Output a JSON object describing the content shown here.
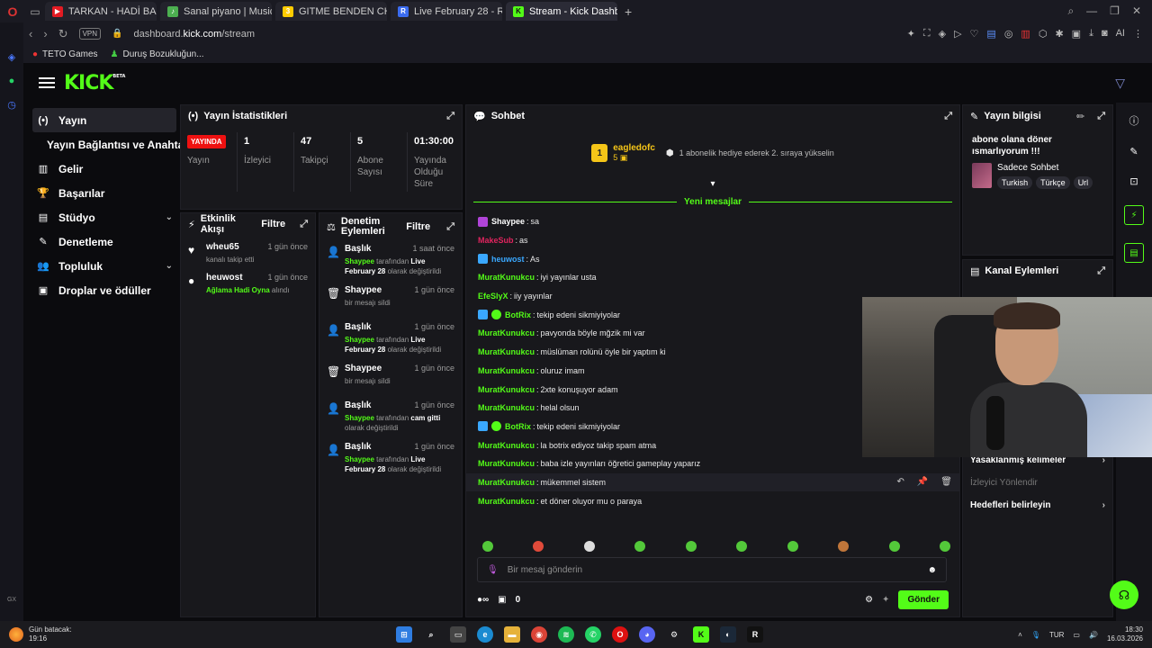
{
  "browser": {
    "tabs": [
      {
        "label": "TARKAN - HADİ BAKALIM",
        "color": "#e31b23",
        "glyph": "▶"
      },
      {
        "label": "Sanal piyano | Musicca",
        "color": "#4caf50",
        "glyph": "♪"
      },
      {
        "label": "GITME BENDEN CHORDS",
        "color": "#ffcc00",
        "glyph": "3"
      },
      {
        "label": "Live February 28 - Restream",
        "color": "#3b6cf0",
        "glyph": "R"
      },
      {
        "label": "Stream - Kick Dashboard",
        "color": "#53fc18",
        "glyph": "K"
      }
    ],
    "url_prefix": "dashboard.",
    "url_domain": "kick.com",
    "url_path": "/stream",
    "vpn_label": "VPN",
    "ai_label": "AI",
    "bookmarks": [
      "TETO Games",
      "Duruş Bozukluğun..."
    ]
  },
  "app": {
    "logo": "KICK",
    "logo_badge": "BETA",
    "sidebar": [
      {
        "label": "Yayın",
        "icon": "broadcast-icon",
        "glyph": "(•)",
        "active": true
      },
      {
        "label": "Yayın Bağlantısı ve Anahtarı",
        "sub": true
      },
      {
        "label": "Gelir",
        "icon": "chart-icon",
        "glyph": "▥"
      },
      {
        "label": "Başarılar",
        "icon": "trophy-icon",
        "glyph": "🏆"
      },
      {
        "label": "Stüdyo",
        "icon": "studio-icon",
        "glyph": "▤",
        "chevron": true
      },
      {
        "label": "Denetleme",
        "icon": "wrench-icon",
        "glyph": "✎"
      },
      {
        "label": "Topluluk",
        "icon": "community-icon",
        "glyph": "👥",
        "chevron": true
      },
      {
        "label": "Droplar ve ödüller",
        "icon": "gift-icon",
        "glyph": "▣"
      }
    ]
  },
  "stats": {
    "title": "Yayın İstatistikleri",
    "live_badge": "YAYINDA",
    "items": [
      {
        "value": "",
        "label": "Yayın"
      },
      {
        "value": "1",
        "label": "İzleyici"
      },
      {
        "value": "47",
        "label": "Takipçi"
      },
      {
        "value": "5",
        "label": "Abone Sayısı"
      },
      {
        "value": "01:30:00",
        "label": "Yayında Olduğu Süre"
      }
    ]
  },
  "activity": {
    "title": "Etkinlik Akışı",
    "filter": "Filtre",
    "items": [
      {
        "icon": "heart-icon",
        "glyph": "♥",
        "user": "wheu65",
        "time": "1 gün önce",
        "text": "kanalı takip etti"
      },
      {
        "icon": "redeem-icon",
        "glyph": "●",
        "user": "heuwost",
        "time": "1 gün önce",
        "highlight": "Ağlama Hadi Oyna",
        "text": " alındı"
      }
    ]
  },
  "moderation": {
    "title": "Denetim Eylemleri",
    "filter": "Filtre",
    "items": [
      {
        "icon": "user-edit-icon",
        "glyph": "👤",
        "title": "Başlık",
        "time": "1 saat önce",
        "actor": "Shaypee",
        "mid": " tarafından ",
        "value": "Live February 28",
        "end": " olarak değiştirildi"
      },
      {
        "icon": "trash-icon",
        "glyph": "🗑",
        "title": "Shaypee",
        "time": "1 gün önce",
        "plain": "bir mesajı sildi"
      },
      {
        "icon": "user-edit-icon",
        "glyph": "👤",
        "title": "Başlık",
        "time": "1 gün önce",
        "actor": "Shaypee",
        "mid": " tarafından ",
        "value": "Live February 28",
        "end": " olarak değiştirildi"
      },
      {
        "icon": "trash-icon",
        "glyph": "🗑",
        "title": "Shaypee",
        "time": "1 gün önce",
        "plain": "bir mesajı sildi"
      },
      {
        "icon": "user-edit-icon",
        "glyph": "👤",
        "title": "Başlık",
        "time": "1 gün önce",
        "actor": "Shaypee",
        "mid": " tarafından ",
        "value": "cam gitti",
        "end": " olarak değiştirildi"
      },
      {
        "icon": "user-edit-icon",
        "glyph": "👤",
        "title": "Başlık",
        "time": "1 gün önce",
        "actor": "Shaypee",
        "mid": " tarafından ",
        "value": "Live February 28",
        "end": " olarak değiştirildi"
      }
    ]
  },
  "chat": {
    "title": "Sohbet",
    "pinned_user": "eagledofc",
    "pinned_rank": "1",
    "pinned_sub": "5",
    "pinned_message": "1 abonelik hediye ederek 2. sıraya yükselin",
    "new_messages": "Yeni mesajlar",
    "messages": [
      {
        "user": "Shaypee",
        "color": "#ffffff",
        "text": "sa",
        "badge": "#b044d8"
      },
      {
        "user": "MakeSub",
        "color": "#e0245e",
        "text": "as"
      },
      {
        "user": "heuwost",
        "color": "#3aa8ff",
        "text": "As",
        "badge": "#3aa8ff"
      },
      {
        "user": "MuratKunukcu",
        "color": "#53fc18",
        "text": "iyi yayınlar usta"
      },
      {
        "user": "EfeSlyX",
        "color": "#53fc18",
        "text": "iiy yayınlar"
      },
      {
        "user": "BotRix",
        "color": "#53fc18",
        "text": "tekip edeni sikmiyiyolar",
        "badge": "#3aa8ff"
      },
      {
        "user": "MuratKunukcu",
        "color": "#53fc18",
        "text": "pavyonda böyle mğzik mi var"
      },
      {
        "user": "MuratKunukcu",
        "color": "#53fc18",
        "text": "müslüman rolünü öyle bir yaptım ki"
      },
      {
        "user": "MuratKunukcu",
        "color": "#53fc18",
        "text": "oluruz imam"
      },
      {
        "user": "MuratKunukcu",
        "color": "#53fc18",
        "text": "2xte konuşuyor adam"
      },
      {
        "user": "MuratKunukcu",
        "color": "#53fc18",
        "text": "helal olsun"
      },
      {
        "user": "BotRix",
        "color": "#53fc18",
        "text": "tekip edeni sikmiyiyolar",
        "badge": "#3aa8ff"
      },
      {
        "user": "MuratKunukcu",
        "color": "#53fc18",
        "text": "la botrix ediyoz takip spam atma"
      },
      {
        "user": "MuratKunukcu",
        "color": "#53fc18",
        "text": "baba izle yayınları öğretici gameplay yaparız"
      },
      {
        "user": "MuratKunukcu",
        "color": "#53fc18",
        "text": "mükemmel sistem",
        "hover": true
      },
      {
        "user": "MuratKunukcu",
        "color": "#53fc18",
        "text": "et döner oluyor mu o paraya"
      }
    ],
    "input_placeholder": "Bir mesaj gönderin",
    "points": "0",
    "send_label": "Gönder"
  },
  "stream_info": {
    "title": "Yayın bilgisi",
    "stream_title": "abone olana döner ısmarlıyorum !!!",
    "category": "Sadece Sohbet",
    "tags": [
      "Turkish",
      "Türkçe",
      "Url"
    ]
  },
  "channel_actions": {
    "title": "Kanal Eylemleri",
    "items": [
      {
        "label": "Yasaklanmış kelimeler",
        "dim": false,
        "chevron": true
      },
      {
        "label": "İzleyici Yönlendir",
        "dim": true,
        "chevron": false
      },
      {
        "label": "Hedefleri belirleyin",
        "dim": false,
        "chevron": true
      }
    ]
  },
  "taskbar": {
    "weather_title": "Gün batacak:",
    "weather_time": "19:16",
    "lang": "TUR",
    "time": "18:30",
    "date": "16.03.2026"
  },
  "colors": {
    "brand": "#53fc18",
    "live": "#e11d1d",
    "bg": "#0b0b0e",
    "panel": "#18181c"
  }
}
